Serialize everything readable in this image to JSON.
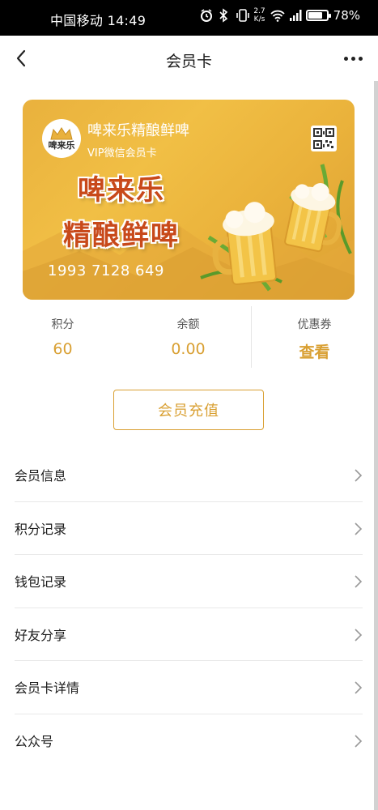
{
  "status_bar": {
    "carrier_time": "中国移动 14:49",
    "net_speed_top": "2.7",
    "net_speed_bottom": "K/s",
    "battery_level": 0.78,
    "battery_text": "78%"
  },
  "nav": {
    "title": "会员卡"
  },
  "card": {
    "brand_name": "啤来乐精酿鲜啤",
    "subtitle": "VIP微信会员卡",
    "logo_text": "啤来乐",
    "hero_line1": "啤来乐",
    "hero_line2": "精酿鲜啤",
    "card_number": "1993 7128 649"
  },
  "stats": [
    {
      "label": "积分",
      "value": "60"
    },
    {
      "label": "余额",
      "value": "0.00"
    },
    {
      "label": "优惠券",
      "value": "查看"
    }
  ],
  "recharge_button": "会员充值",
  "menu": [
    {
      "label": "会员信息"
    },
    {
      "label": "积分记录"
    },
    {
      "label": "钱包记录"
    },
    {
      "label": "好友分享"
    },
    {
      "label": "会员卡详情"
    },
    {
      "label": "公众号"
    }
  ],
  "colors": {
    "accent": "#d9a033",
    "card_base": "#f1bf45",
    "hero_text": "#c8491a"
  }
}
